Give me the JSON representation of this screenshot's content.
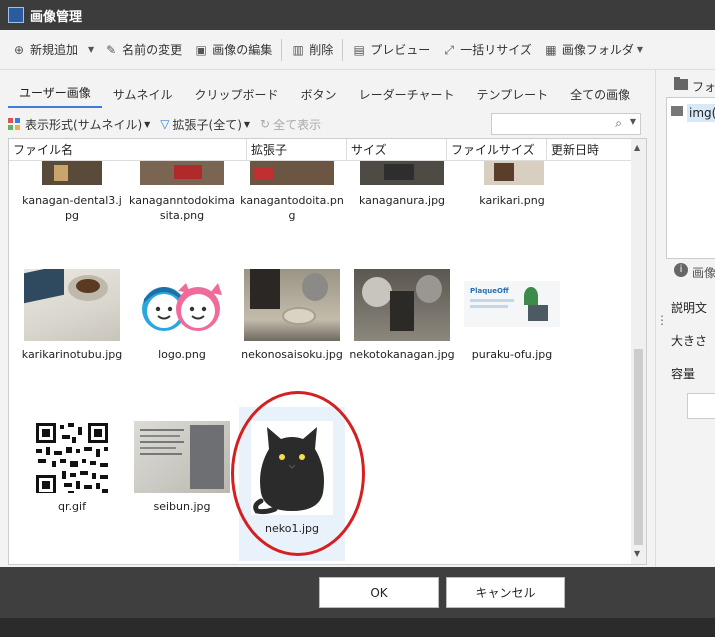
{
  "window": {
    "title": "画像管理"
  },
  "toolbar": {
    "new": "新規追加",
    "rename": "名前の変更",
    "edit": "画像の編集",
    "delete": "削除",
    "preview": "プレビュー",
    "resize": "一括リサイズ",
    "folder": "画像フォルダ"
  },
  "tabs": [
    "ユーザー画像",
    "サムネイル",
    "クリップボード",
    "ボタン",
    "レーダーチャート",
    "テンプレート",
    "全ての画像"
  ],
  "filters": {
    "display": "表示形式(サムネイル)",
    "extension": "拡張子(全て)",
    "show_all": "全て表示"
  },
  "search": {
    "value": "",
    "placeholder": ""
  },
  "columns": [
    "ファイル名",
    "拡張子",
    "サイズ",
    "ファイルサイズ",
    "更新日時"
  ],
  "files": [
    "kanagan-dental3.jpg",
    "kanaganntodokimasita.png",
    "kanagantodoita.png",
    "kanaganura.jpg",
    "karikari.png",
    "karikarinotubu.jpg",
    "logo.png",
    "nekonosaisoku.jpg",
    "nekotokanagan.jpg",
    "puraku-ofu.jpg",
    "qr.gif",
    "seibun.jpg",
    "neko1.jpg"
  ],
  "right_panel": {
    "folder_header": "フォル",
    "folder_node": "img(",
    "info_header": "画像",
    "description": "説明文",
    "size": "大きさ",
    "capacity": "容量"
  },
  "buttons": {
    "ok": "OK",
    "cancel": "キャンセル"
  },
  "icons": {
    "new": "plus-circle-icon",
    "rename": "pencil-icon",
    "edit": "image-edit-icon",
    "delete": "trash-icon",
    "preview": "preview-icon",
    "resize": "resize-icon",
    "folder": "folder-image-icon"
  },
  "colors": {
    "accent": "#3a7fd5",
    "highlight": "#d42020",
    "titlebar": "#3c3c3c"
  }
}
